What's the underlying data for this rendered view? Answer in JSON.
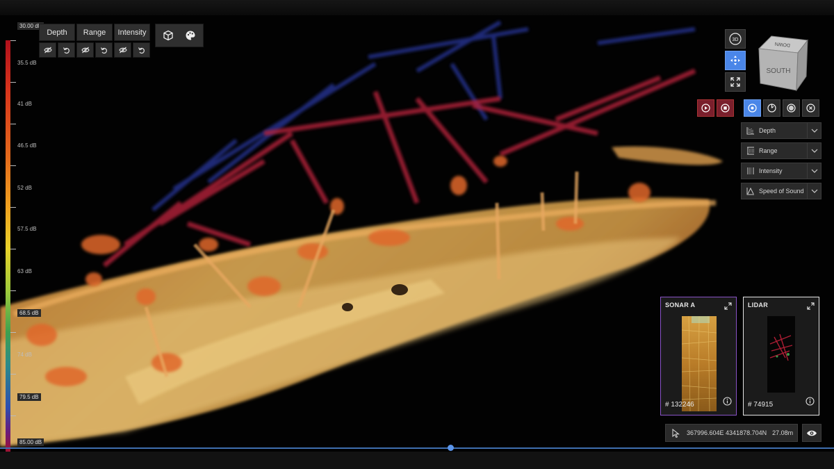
{
  "scale": {
    "ticks": [
      "30.00 dB",
      "35.5 dB",
      "41 dB",
      "46.5 dB",
      "52 dB",
      "57.5 dB",
      "63 dB",
      "68.5 dB",
      "74 dB",
      "79.5 dB",
      "85.00 dB"
    ]
  },
  "toolbar": {
    "layers": [
      {
        "label": "Depth"
      },
      {
        "label": "Range"
      },
      {
        "label": "Intensity"
      }
    ]
  },
  "nav": {
    "view_3d_label": "3D",
    "cube_front": "SOUTH",
    "cube_top": "DOWN"
  },
  "dropdowns": [
    {
      "label": "Depth",
      "icon": "depth-icon"
    },
    {
      "label": "Range",
      "icon": "range-icon"
    },
    {
      "label": "Intensity",
      "icon": "intensity-icon"
    },
    {
      "label": "Speed of Sound",
      "icon": "speed-of-sound-icon"
    }
  ],
  "thumbnails": {
    "sonar": {
      "title": "SONAR A",
      "id": "# 132246"
    },
    "lidar": {
      "title": "LIDAR",
      "id": "# 74915"
    }
  },
  "coords": {
    "position": "367996.604E 4341878.704N",
    "depth": "27.08m"
  },
  "timeline": {
    "progress": 0.54
  },
  "colors": {
    "accent": "#4a86e8",
    "sonar_border": "#8a54c8",
    "record": "#7a1f2c"
  }
}
